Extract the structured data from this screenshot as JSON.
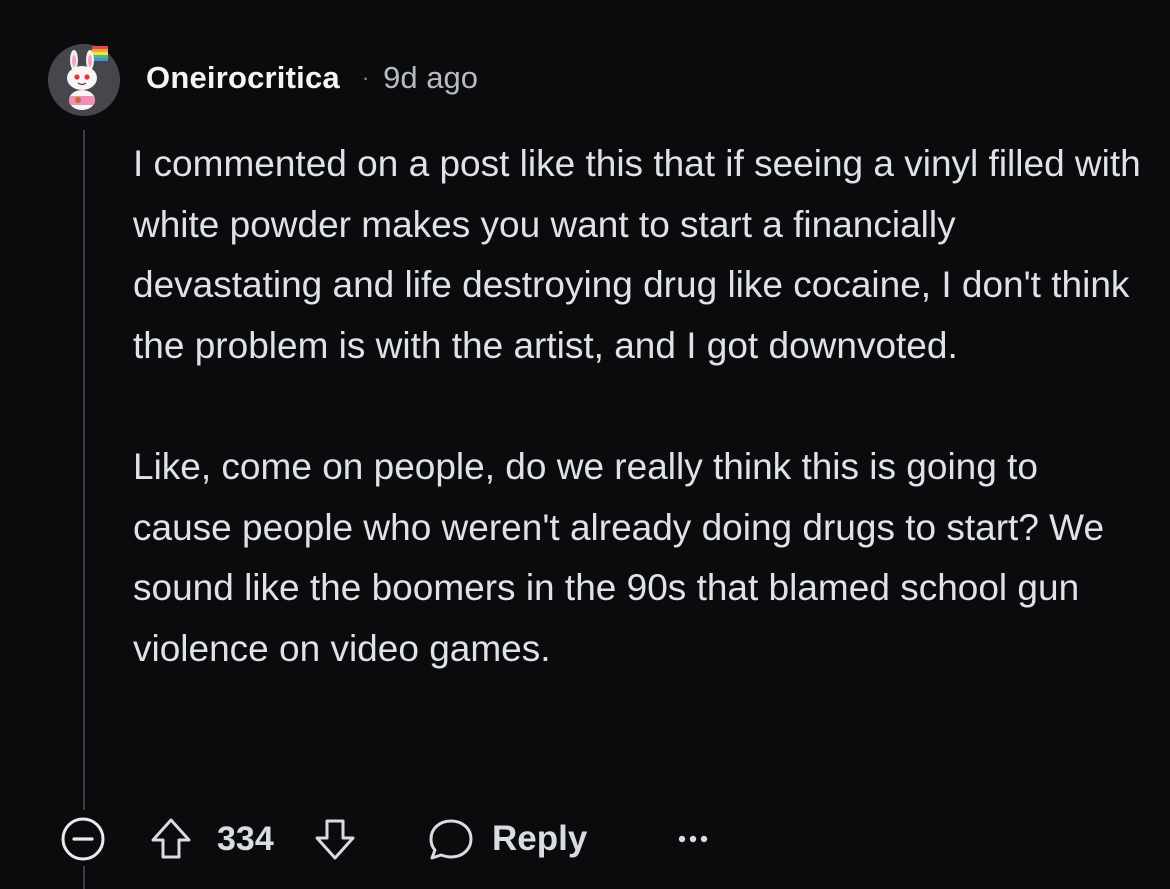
{
  "comment": {
    "author": "Oneirocritica",
    "separator": "·",
    "age": "9d ago",
    "avatar_icon": "snoo-avatar-icon",
    "paragraphs": [
      "I commented on a post like this that if seeing a vinyl filled with white powder makes you want to start a financially devastating and life destroying drug like cocaine, I don't think the problem is with the artist, and I got downvoted.",
      "Like, come on people, do we really think this is going to cause people who weren't already doing drugs to start? We sound like the boomers in the 90s that blamed school gun violence on video games."
    ]
  },
  "actions": {
    "collapse_icon": "collapse-minus-icon",
    "upvote_icon": "upvote-arrow-icon",
    "score": "334",
    "downvote_icon": "downvote-arrow-icon",
    "reply_icon": "speech-bubble-icon",
    "reply_label": "Reply",
    "more_icon": "more-options-icon"
  },
  "colors": {
    "background": "#0b0b0d",
    "text": "#dde3e6",
    "muted": "#b5bcc0",
    "thread_line": "#3a3d41"
  }
}
